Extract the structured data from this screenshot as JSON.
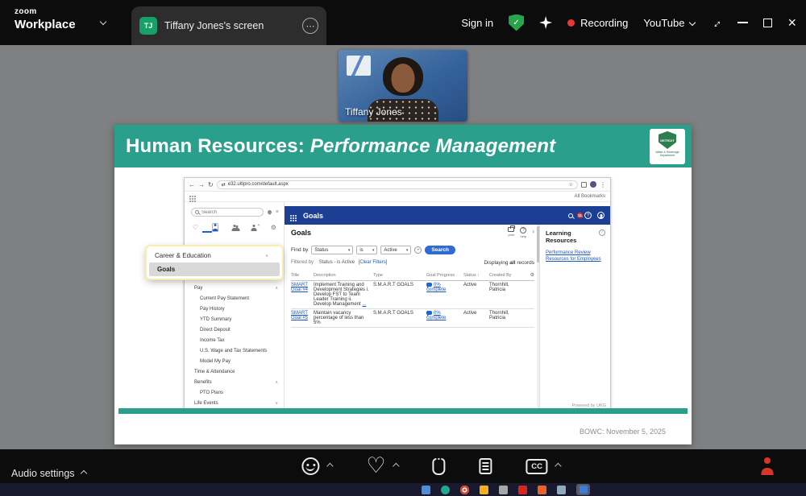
{
  "colors": {
    "slide_accent_teal": "#2aa08c",
    "ultipro_header_blue": "#1c3f94",
    "link_blue": "#1a56c4",
    "recording_red": "#e53935",
    "shield_green": "#27a44c"
  },
  "icons": {
    "ellipsis": "⋯",
    "more_vertical": "⋮",
    "back": "←",
    "forward": "→",
    "reload": "↻",
    "star": "☆",
    "swap": "⇄",
    "close": "×",
    "check": "✓",
    "caret": "▾",
    "chev_up": "∧",
    "chev_down": "∨",
    "sort_up": "↑",
    "heart": "♡",
    "gear": "⚙",
    "plus": "+",
    "question": "?",
    "info": "i",
    "expand": "↔",
    "angle_right": "›"
  },
  "titlebar": {
    "logo_top": "zoom",
    "logo_bottom": "Workplace",
    "tab_initials": "TJ",
    "tab_label": "Tiffany Jones's screen",
    "sign_in": "Sign in",
    "recording": "Recording",
    "youtube": "YouTube"
  },
  "video": {
    "participant": "Tiffany Jones"
  },
  "slide": {
    "title_prefix": "Human Resources: ",
    "title_italic": "Performance Management",
    "logo_text": "DETROIT",
    "logo_caption": "Water & Sewerage Department",
    "footer": "BOWC: November 5, 2025"
  },
  "browser": {
    "url": "e32.ultipro.com/default.aspx",
    "all_bookmarks": "All Bookmarks"
  },
  "ultipro": {
    "header_title": "Goals",
    "badge": "11",
    "search_placeholder": "Search",
    "menu_card": {
      "section": "Career & Education",
      "selected": "Goals"
    },
    "menu": [
      "Pay",
      "Current Pay Statement",
      "Pay History",
      "YTD Summary",
      "Direct Deposit",
      "Income Tax",
      "U.S. Wage and Tax Statements",
      "Model My Pay",
      "Time & Attendance",
      "Benefits",
      "PTO Plans",
      "Life Events"
    ],
    "page_title": "Goals",
    "toolbar": {
      "print": "print",
      "help": "help"
    },
    "filters": {
      "find_by": "Find by",
      "field": "Status",
      "op": "is",
      "value": "Active",
      "search": "Search",
      "filtered_prefix": "Filtered by",
      "filtered_text": "Status - is Active",
      "clear": "[Clear Filters]",
      "displaying_1": "Displaying ",
      "displaying_2": "all",
      "displaying_3": " records"
    },
    "table": {
      "h_title": "Title",
      "h_desc": "Description",
      "h_type": "Type",
      "h_progress": "Goal Progress",
      "h_status": "Status",
      "h_created": "Created By",
      "rows": [
        {
          "title": "SMART Goal #4",
          "desc": "Implement Training and Development Strategies  i. Develop FST to Team Leader Training ii. Develop Management ",
          "more": "...",
          "type": "S.M.A.R.T GOALS",
          "pct": "0%",
          "progress_link": "complete",
          "status": "Active",
          "created": "Thornhill, Patricia"
        },
        {
          "title": "SMART Goal #5",
          "desc": "Maintain vacancy percentage of less than 5%",
          "more": "",
          "type": "S.M.A.R.T GOALS",
          "pct": "0%",
          "progress_link": "complete",
          "status": "Active",
          "created": "Thornhill, Patricia"
        }
      ]
    },
    "learning": {
      "title": "Learning Resources",
      "link": "Performance Review Resources for Employees"
    },
    "powered_by": "Powered by UKG"
  },
  "controls": {
    "audio_settings": "Audio settings",
    "cc": "CC"
  }
}
